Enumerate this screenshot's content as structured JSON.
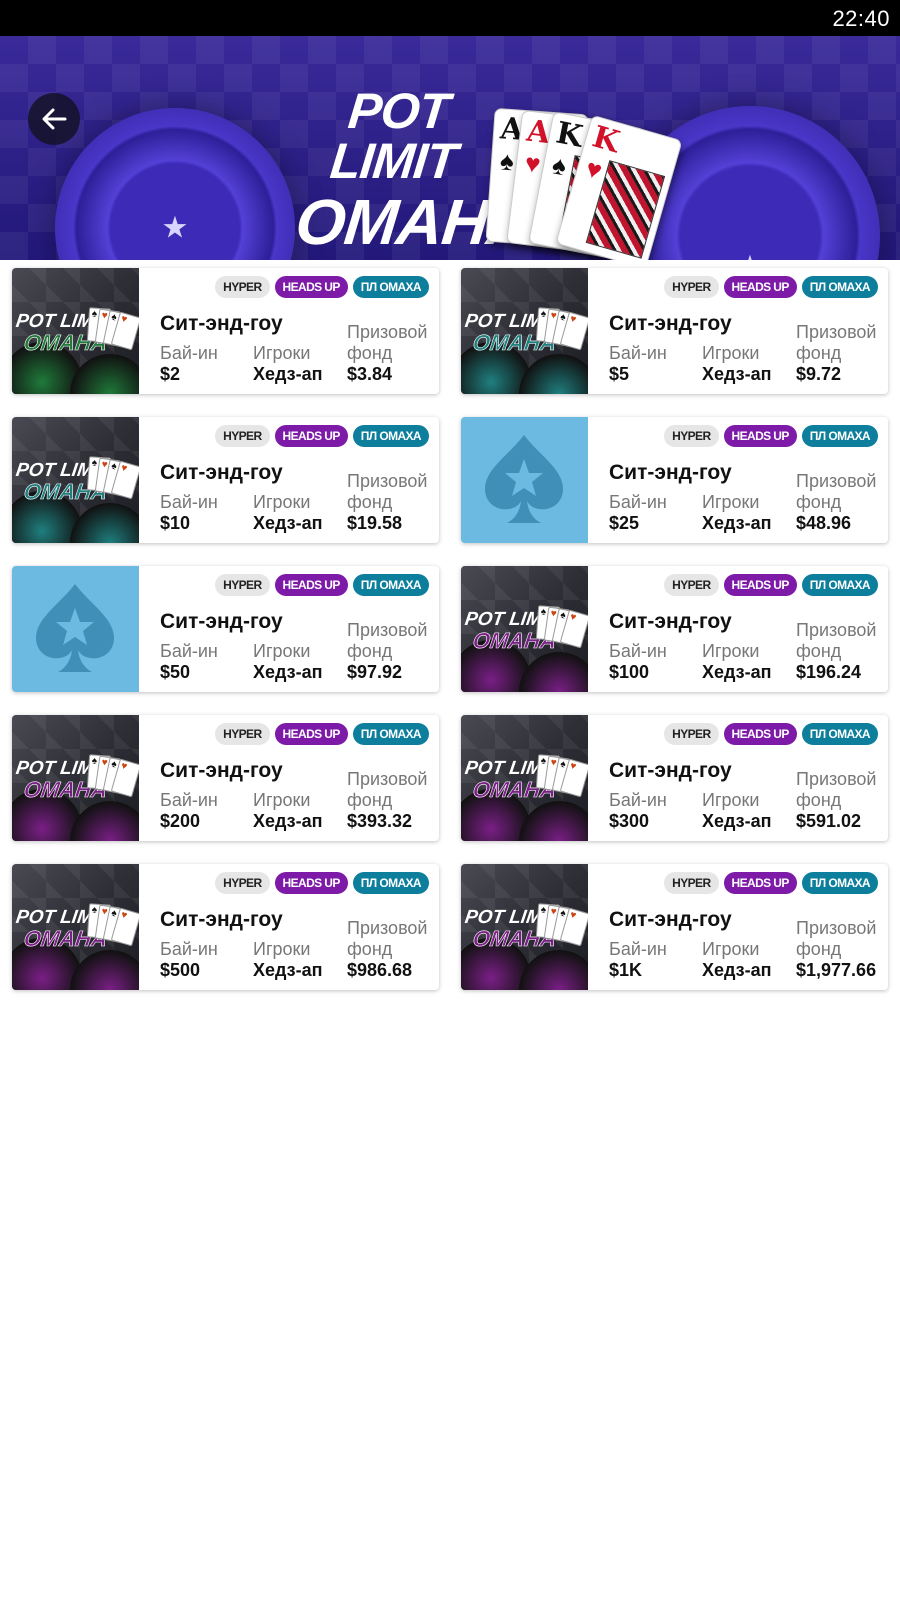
{
  "status_bar": {
    "time": "22:40"
  },
  "banner": {
    "title_line1": "POT LIMIT",
    "title_line2": "OMAHA",
    "cards": [
      "A",
      "A",
      "K",
      "K"
    ]
  },
  "badges": {
    "hyper": "HYPER",
    "heads_up": "HEADS UP",
    "plo": "ПЛ ОМАХА"
  },
  "labels": {
    "buyin": "Бай-ин",
    "players": "Игроки",
    "prize": "Призовой фонд"
  },
  "thumb_text": {
    "line1": "POT LIMIT",
    "line2": "OMAHA"
  },
  "colors": {
    "hu_badge": "#7d1aa8",
    "plo_badge": "#0d7f9c",
    "green_theme": "#1f7a3a",
    "teal_theme": "#1f7f7f",
    "purple_theme": "#7a1f86",
    "blue_tile": "#6cb9e2"
  },
  "tournaments": [
    {
      "title": "Сит-энд-гоу",
      "buyin": "$2",
      "players": "Хедз-ап",
      "prize": "$3.84",
      "thumb": "green"
    },
    {
      "title": "Сит-энд-гоу",
      "buyin": "$5",
      "players": "Хедз-ап",
      "prize": "$9.72",
      "thumb": "teal"
    },
    {
      "title": "Сит-энд-гоу",
      "buyin": "$10",
      "players": "Хедз-ап",
      "prize": "$19.58",
      "thumb": "teal"
    },
    {
      "title": "Сит-энд-гоу",
      "buyin": "$25",
      "players": "Хедз-ап",
      "prize": "$48.96",
      "thumb": "spade"
    },
    {
      "title": "Сит-энд-гоу",
      "buyin": "$50",
      "players": "Хедз-ап",
      "prize": "$97.92",
      "thumb": "spade"
    },
    {
      "title": "Сит-энд-гоу",
      "buyin": "$100",
      "players": "Хедз-ап",
      "prize": "$196.24",
      "thumb": "purple"
    },
    {
      "title": "Сит-энд-гоу",
      "buyin": "$200",
      "players": "Хедз-ап",
      "prize": "$393.32",
      "thumb": "purple"
    },
    {
      "title": "Сит-энд-гоу",
      "buyin": "$300",
      "players": "Хедз-ап",
      "prize": "$591.02",
      "thumb": "purple"
    },
    {
      "title": "Сит-энд-гоу",
      "buyin": "$500",
      "players": "Хедз-ап",
      "prize": "$986.68",
      "thumb": "purple"
    },
    {
      "title": "Сит-энд-гоу",
      "buyin": "$1K",
      "players": "Хедз-ап",
      "prize": "$1,977.66",
      "thumb": "purple"
    }
  ]
}
